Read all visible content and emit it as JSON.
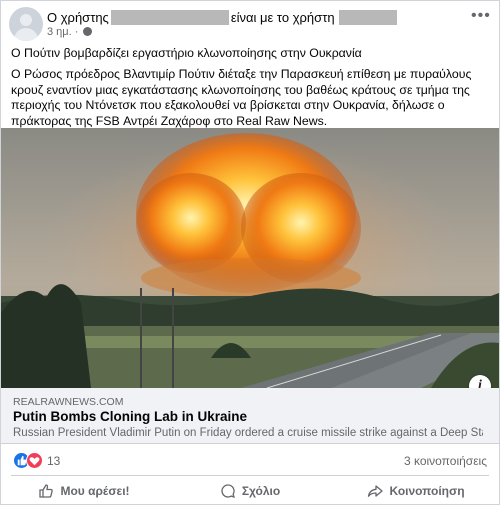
{
  "post": {
    "author_prefix": "Ο χρήστης",
    "author_middle": "είναι με το χρήστη",
    "time": "3 ημ.",
    "headline": "Ο Πούτιν βομβαρδίζει εργαστήριο κλωνοποίησης στην Ουκρανία",
    "body": "Ο Ρώσος πρόεδρος Βλαντιμίρ Πούτιν διέταξε την Παρασκευή επίθεση με πυραύλους κρουζ εναντίον μιας εγκατάστασης κλωνοποίησης του βαθέως κράτους σε τμήμα της περιοχής του Ντόνετσκ που εξακολουθεί να βρίσκεται στην Ουκρανία, δήλωσε ο πράκτορας της FSB Αντρέι Ζαχάροφ στο Real Raw News."
  },
  "link_preview": {
    "domain": "REALRAWNEWS.COM",
    "title": "Putin Bombs Cloning Lab in Ukraine",
    "description": "Russian President Vladimir Putin on Friday ordered a cruise missile strike against a Deep State ...",
    "info_glyph": "i"
  },
  "engagement": {
    "reaction_count": "13",
    "shares": "3 κοινοποιήσεις"
  },
  "actions": {
    "like": "Μου αρέσει!",
    "comment": "Σχόλιο",
    "share": "Κοινοποίηση"
  },
  "icons": {
    "like": "thumbs-up-icon",
    "comment": "comment-icon",
    "share": "share-icon",
    "menu": "more-dots-icon",
    "privacy": "globe-icon"
  },
  "colors": {
    "like_reaction": "#1b74e4",
    "love_reaction": "#f33e58",
    "secondary_text": "#65676b"
  }
}
